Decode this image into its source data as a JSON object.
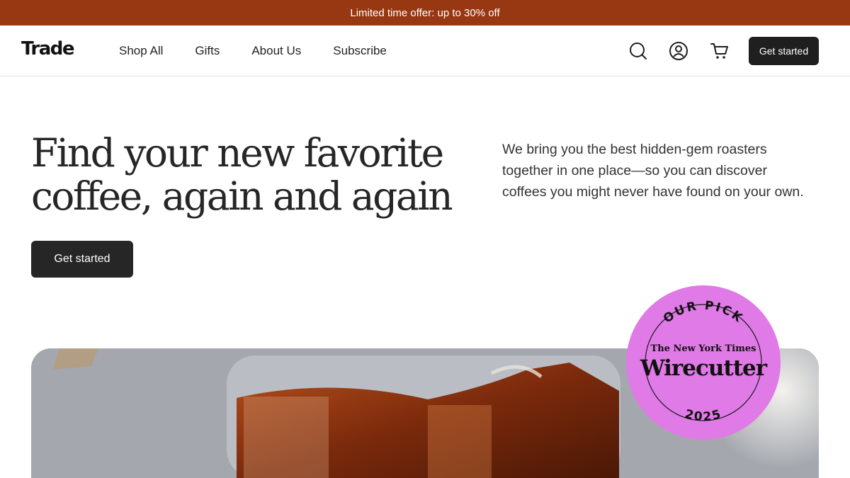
{
  "promo": {
    "text": "Limited time offer: up to 30% off"
  },
  "header": {
    "logo": "Trade",
    "nav": [
      "Shop All",
      "Gifts",
      "About Us",
      "Subscribe"
    ],
    "icons": [
      "search-icon",
      "account-icon",
      "cart-icon"
    ],
    "cta": "Get started"
  },
  "hero": {
    "title_line1": "Find your new favorite",
    "title_line2": "coffee, again and again",
    "description": "We bring you the best hidden-gem roasters together in one place—so you can discover coffees you might never have found on your own.",
    "cta": "Get started"
  },
  "badge": {
    "top_text": "OUR PICK",
    "publisher": "The New York Times",
    "brand": "Wirecutter",
    "year": "2025"
  },
  "colors": {
    "promo_bg": "#983812",
    "button_bg": "#1f1f1f",
    "badge_bg": "#df7ae6"
  }
}
